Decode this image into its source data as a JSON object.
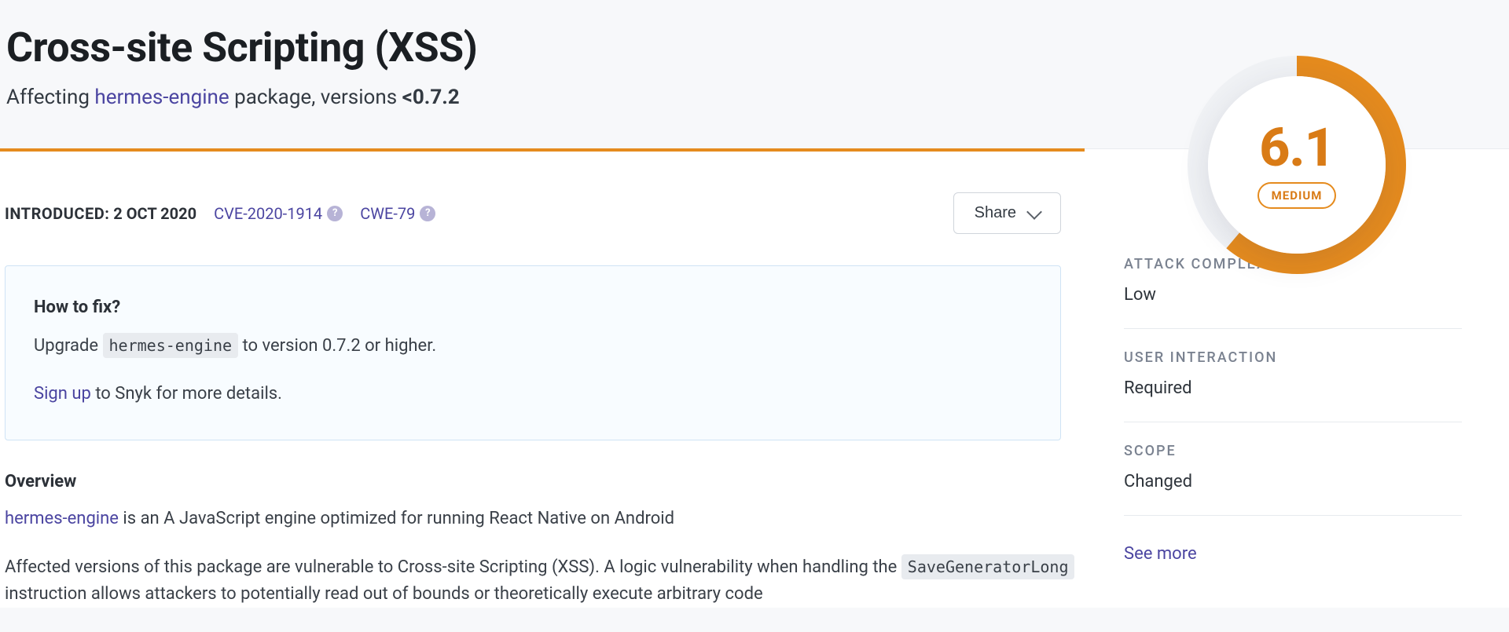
{
  "header": {
    "title": "Cross-site Scripting (XSS)",
    "affecting_prefix": "Affecting ",
    "package_name": "hermes-engine",
    "affecting_suffix": " package, versions ",
    "versions": "<0.7.2"
  },
  "meta": {
    "introduced_label": "INTRODUCED:",
    "introduced_date": "2 OCT 2020",
    "cve": "CVE-2020-1914",
    "cwe": "CWE-79",
    "share_label": "Share"
  },
  "fix": {
    "heading": "How to fix?",
    "line_prefix": "Upgrade ",
    "package_code": "hermes-engine",
    "line_suffix": " to version 0.7.2 or higher.",
    "signup_link": "Sign up",
    "signup_rest": " to Snyk for more details."
  },
  "overview": {
    "heading": "Overview",
    "pkg_link": "hermes-engine",
    "desc_rest": " is an A JavaScript engine optimized for running React Native on Android",
    "para2_a": "Affected versions of this package are vulnerable to Cross-site Scripting (XSS). A logic vulnerability when handling the ",
    "para2_code": "SaveGeneratorLong",
    "para2_b": " instruction allows attackers to potentially read out of bounds or theoretically execute arbitrary code"
  },
  "score": {
    "value": "6.1",
    "severity": "MEDIUM"
  },
  "metrics": [
    {
      "label": "ATTACK COMPLEXITY",
      "value": "Low"
    },
    {
      "label": "USER INTERACTION",
      "value": "Required"
    },
    {
      "label": "SCOPE",
      "value": "Changed"
    }
  ],
  "see_more": "See more"
}
